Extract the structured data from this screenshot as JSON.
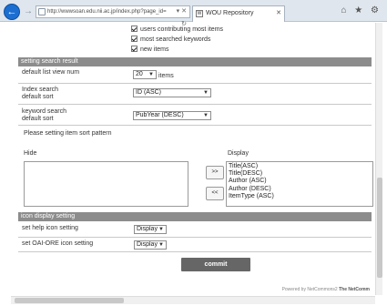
{
  "browser": {
    "address": "http://wwwsoan.edu.nii.ac.jp/index.php?page_id=",
    "address_btns": "▾ ✕ ↻",
    "tab_title": "WOU Repository",
    "tab_favicon": "W",
    "tab_close": "✕",
    "back": "←",
    "forward": "→",
    "icons": "⌂ ★ ⚙"
  },
  "ranking": {
    "options": [
      {
        "label": "users contributing most items",
        "checked": true
      },
      {
        "label": "most searched keywords",
        "checked": true
      },
      {
        "label": "new items",
        "checked": true
      }
    ]
  },
  "search_result": {
    "header": "setting search   result",
    "list_view_label": "default list view num",
    "list_view_value": "20",
    "list_view_unit": "items",
    "index_sort_label_1": "Index search",
    "index_sort_label_2": "default sort",
    "index_sort_value": "ID  (ASC)",
    "keyword_sort_label_1": "keyword search",
    "keyword_sort_label_2": "default sort",
    "keyword_sort_value": "PubYear  (DESC)",
    "pattern_label": "Please setting item sort pattern",
    "hide_label": "Hide",
    "display_label": "Display",
    "hide_items": [],
    "display_items": [
      "Title(ASC)",
      "Title(DESC)",
      "Author  (ASC)",
      "Author  (DESC)",
      "ItemType  (ASC)"
    ],
    "move_right": ">>",
    "move_left": "<<"
  },
  "icon_display": {
    "header": "icon display setting",
    "help_label": "set help icon setting",
    "help_value": "Display",
    "oai_label": "set OAI-ORE icon setting",
    "oai_value": "Display"
  },
  "commit_label": "commit",
  "footer": {
    "powered": "Powered by NetCommons2 ",
    "project": "The NetComm"
  }
}
